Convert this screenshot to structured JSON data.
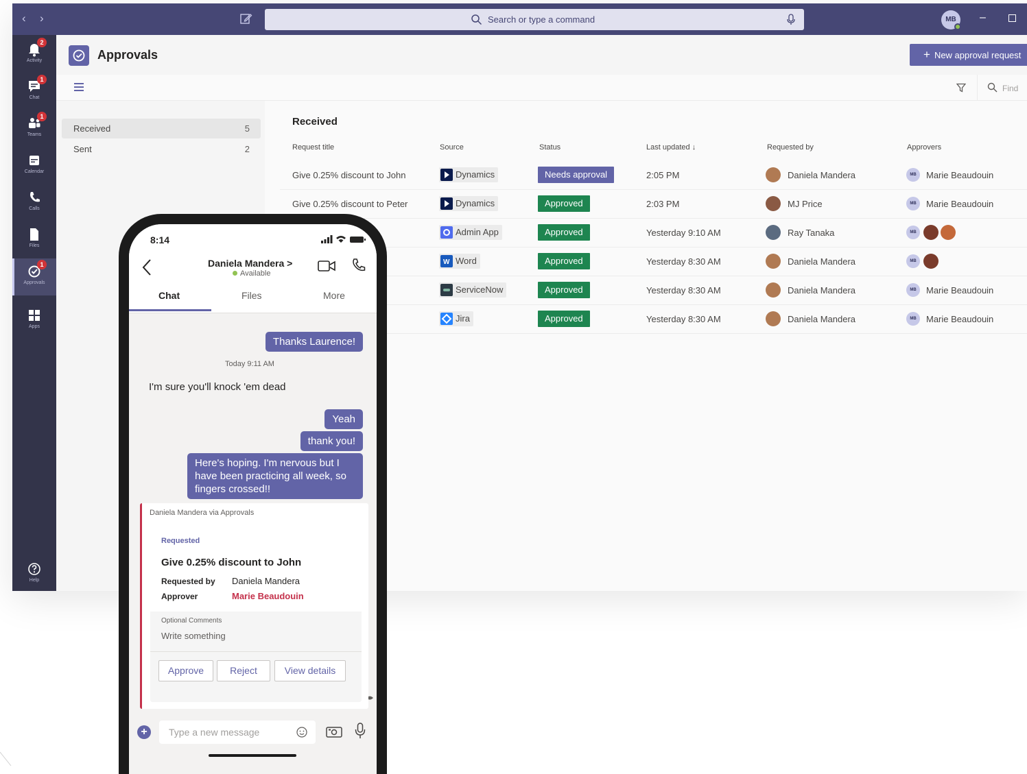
{
  "desktop": {
    "search": {
      "placeholder": "Search or type a command"
    },
    "user_initials": "MB",
    "rail": [
      {
        "label": "Activity",
        "icon": "bell-icon",
        "badge": "2"
      },
      {
        "label": "Chat",
        "icon": "chat-icon",
        "badge": "1"
      },
      {
        "label": "Teams",
        "icon": "teams-icon",
        "badge": "1"
      },
      {
        "label": "Calendar",
        "icon": "calendar-icon",
        "badge": ""
      },
      {
        "label": "Calls",
        "icon": "phone-icon",
        "badge": ""
      },
      {
        "label": "Files",
        "icon": "file-icon",
        "badge": ""
      },
      {
        "label": "Approvals",
        "icon": "approvals-icon",
        "badge": "1"
      },
      {
        "label": "Apps",
        "icon": "apps-icon",
        "badge": ""
      },
      {
        "label": "Help",
        "icon": "help-icon",
        "badge": ""
      }
    ],
    "app": {
      "title": "Approvals",
      "new_button": "New approval request",
      "find": "Find"
    },
    "sidebar": [
      {
        "label": "Received",
        "count": "5"
      },
      {
        "label": "Sent",
        "count": "2"
      }
    ],
    "main": {
      "title": "Received",
      "columns": {
        "title": "Request title",
        "source": "Source",
        "status": "Status",
        "updated": "Last updated",
        "requested_by": "Requested by",
        "approvers": "Approvers"
      },
      "rows": [
        {
          "title": "Give 0.25% discount to John",
          "source": "Dynamics",
          "status": "Needs approval",
          "updated": "2:05 PM",
          "requested_by": "Daniela Mandera",
          "approvers": "Marie Beaudouin"
        },
        {
          "title": "Give 0.25% discount to Peter",
          "source": "Dynamics",
          "status": "Approved",
          "updated": "2:03 PM",
          "requested_by": "MJ Price",
          "approvers": "Marie Beaudouin"
        },
        {
          "title": "",
          "source": "Admin App",
          "status": "Approved",
          "updated": "Yesterday 9:10 AM",
          "requested_by": "Ray Tanaka",
          "approvers": ""
        },
        {
          "title": "",
          "source": "Word",
          "status": "Approved",
          "updated": "Yesterday 8:30 AM",
          "requested_by": "Daniela Mandera",
          "approvers": ""
        },
        {
          "title": "",
          "source": "ServiceNow",
          "status": "Approved",
          "updated": "Yesterday 8:30 AM",
          "requested_by": "Daniela Mandera",
          "approvers": "Marie Beaudouin"
        },
        {
          "title": "",
          "source": "Jira",
          "status": "Approved",
          "updated": "Yesterday 8:30 AM",
          "requested_by": "Daniela Mandera",
          "approvers": "Marie Beaudouin"
        }
      ]
    }
  },
  "phone": {
    "time": "8:14",
    "contact_name": "Daniela Mandera >",
    "presence": "Available",
    "tabs": [
      "Chat",
      "Files",
      "More"
    ],
    "messages": {
      "m1": "Thanks Laurence!",
      "timestamp": "Today 9:11 AM",
      "them": "I'm sure you'll knock 'em dead",
      "m2": "Yeah",
      "m3": "thank you!",
      "m4": "Here's hoping. I'm nervous but I have been practicing all week, so fingers crossed!!"
    },
    "card": {
      "from": "Daniela Mandera via Approvals",
      "state": "Requested",
      "title": "Give 0.25% discount to John",
      "requested_by_label": "Requested by",
      "requested_by": "Daniela Mandera",
      "approver_label": "Approver",
      "approver": "Marie Beaudouin",
      "comments_label": "Optional Comments",
      "comments_placeholder": "Write something",
      "buttons": {
        "approve": "Approve",
        "reject": "Reject",
        "details": "View details"
      }
    },
    "compose_placeholder": "Type a new message"
  },
  "colors": {
    "accent": "#6264a7",
    "titlebar": "#464775",
    "rail": "#33344a",
    "approved": "#1e8550",
    "alert": "#c4314b"
  }
}
